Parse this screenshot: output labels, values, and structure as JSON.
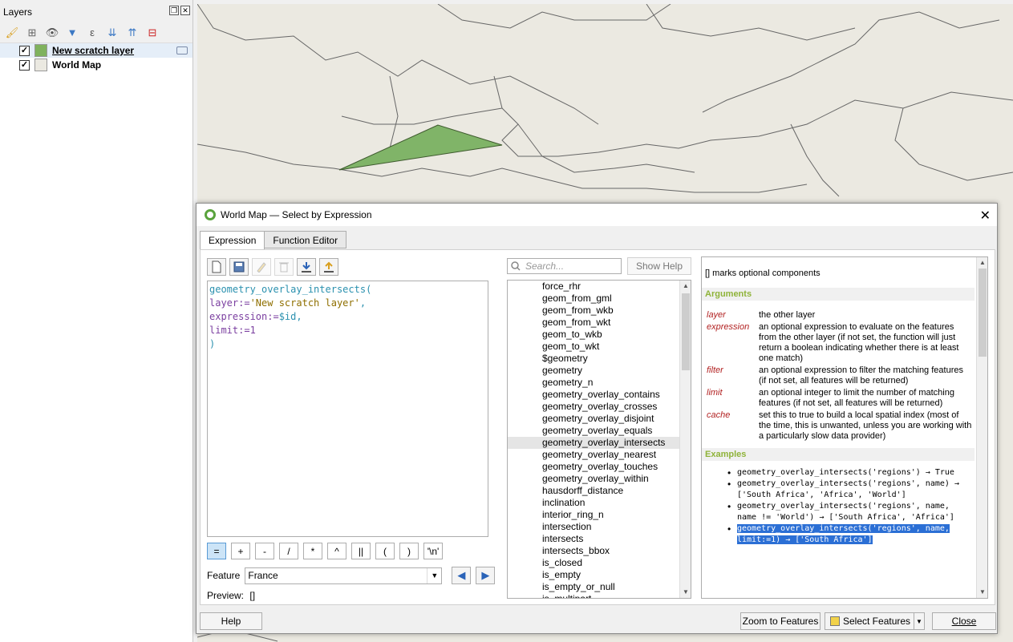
{
  "layers_panel": {
    "title": "Layers",
    "layers": [
      {
        "name": "New scratch layer",
        "checked": "✓",
        "swatch_color": "#7fb25e"
      },
      {
        "name": "World Map",
        "checked": "✓",
        "swatch_color": "#ebe9e1"
      }
    ]
  },
  "map": {
    "background": "#ebe9e1",
    "triangle_color": "#80b468"
  },
  "dialog": {
    "title": "World Map — Select by Expression",
    "tabs": [
      "Expression",
      "Function Editor"
    ],
    "expression_lines": {
      "l1": "geometry_overlay_intersects(",
      "l2_param": " layer:=",
      "l2_str": "'New scratch layer'",
      "l2_end": ",",
      "l3_param": " expression:=",
      "l3_var": "$id",
      "l3_end": ",",
      "l4_param": " limit:=",
      "l4_num": "1",
      "l5": ")"
    },
    "operators": [
      "=",
      "+",
      "-",
      "/",
      "*",
      "^",
      "||",
      "(",
      ")",
      "'\\n'"
    ],
    "feature_label": "Feature",
    "feature_value": "France",
    "preview_label": "Preview:",
    "preview_value": "[]",
    "search_placeholder": "Search...",
    "show_help": "Show Help",
    "functions": [
      "force_rhr",
      "geom_from_gml",
      "geom_from_wkb",
      "geom_from_wkt",
      "geom_to_wkb",
      "geom_to_wkt",
      "$geometry",
      "geometry",
      "geometry_n",
      "geometry_overlay_contains",
      "geometry_overlay_crosses",
      "geometry_overlay_disjoint",
      "geometry_overlay_equals",
      "geometry_overlay_intersects",
      "geometry_overlay_nearest",
      "geometry_overlay_touches",
      "geometry_overlay_within",
      "hausdorff_distance",
      "inclination",
      "interior_ring_n",
      "intersection",
      "intersects",
      "intersects_bbox",
      "is_closed",
      "is_empty",
      "is_empty_or_null",
      "is_multipart"
    ],
    "selected_function": "geometry_overlay_intersects",
    "help": {
      "note": "[] marks optional components",
      "arguments_title": "Arguments",
      "arguments": [
        {
          "name": "layer",
          "desc": "the other layer"
        },
        {
          "name": "expression",
          "desc": "an optional expression to evaluate on the features from the other layer (if not set, the function will just return a boolean indicating whether there is at least one match)"
        },
        {
          "name": "filter",
          "desc": "an optional expression to filter the matching features (if not set, all features will be returned)"
        },
        {
          "name": "limit",
          "desc": "an optional integer to limit the number of matching features (if not set, all features will be returned)"
        },
        {
          "name": "cache",
          "desc": "set this to true to build a local spatial index (most of the time, this is unwanted, unless you are working with a particularly slow data provider)"
        }
      ],
      "examples_title": "Examples",
      "examples": [
        "geometry_overlay_intersects('regions') → True",
        "geometry_overlay_intersects('regions', name) → ['South Africa', 'Africa', 'World']",
        "geometry_overlay_intersects('regions', name, name != 'World') → ['South Africa', 'Africa']",
        "geometry_overlay_intersects('regions', name, limit:=1) → ['South Africa']"
      ]
    },
    "buttons": {
      "help": "Help",
      "zoom": "Zoom to Features",
      "select": "Select Features",
      "close": "Close"
    }
  }
}
